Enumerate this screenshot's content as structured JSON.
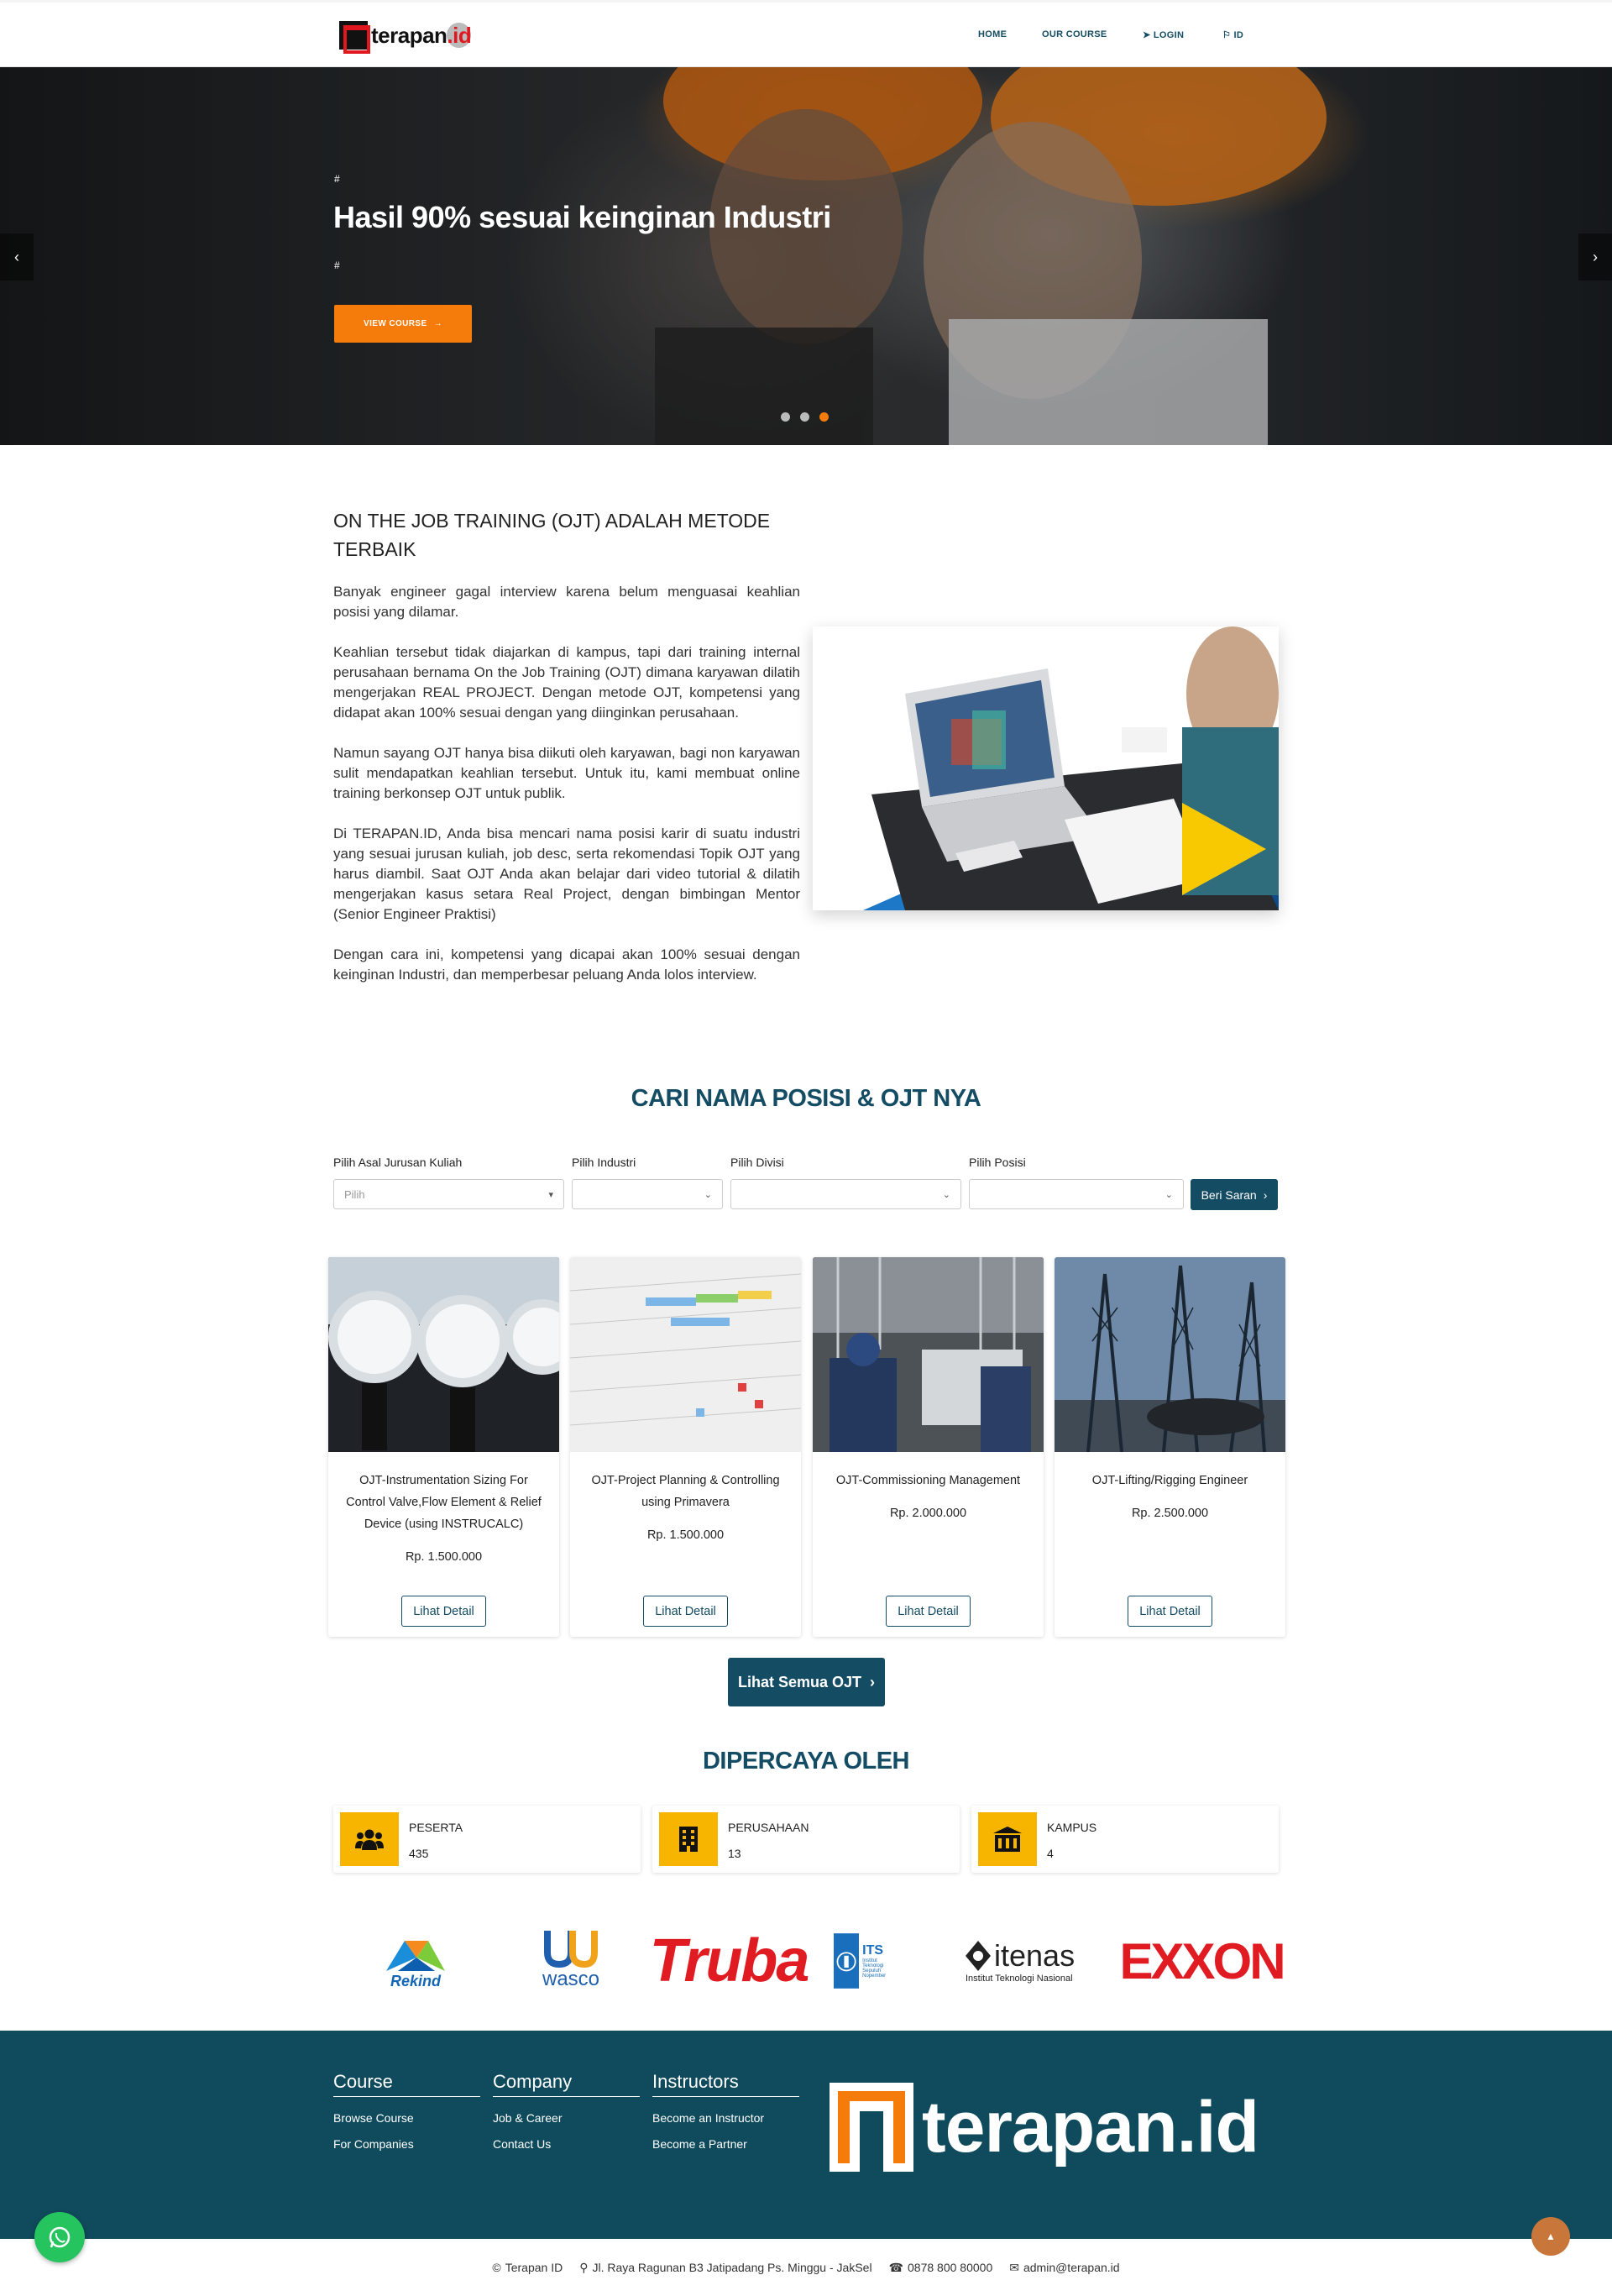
{
  "brand": {
    "name": "terapan",
    "tld": ".id"
  },
  "nav": {
    "home": "HOME",
    "course": "OUR COURSE",
    "login": "LOGIN",
    "lang": "ID"
  },
  "hero": {
    "hash_top": "#",
    "title": "Hasil 90% sesuai keinginan Industri",
    "hash_bottom": "#",
    "button": "VIEW COURSE"
  },
  "about": {
    "title": "ON THE JOB TRAINING (OJT) ADALAH METODE TERBAIK",
    "paragraphs": [
      "Banyak engineer gagal interview karena belum menguasai keahlian posisi yang dilamar.",
      "Keahlian tersebut tidak diajarkan di kampus, tapi dari training internal perusahaan bernama On the Job Training (OJT) dimana karyawan dilatih mengerjakan REAL PROJECT. Dengan metode OJT, kompetensi yang didapat akan 100% sesuai dengan yang diinginkan perusahaan.",
      "Namun sayang OJT hanya bisa diikuti oleh karyawan, bagi non karyawan sulit mendapatkan keahlian tersebut. Untuk itu, kami membuat online training berkonsep OJT untuk publik.",
      "Di TERAPAN.ID, Anda bisa mencari nama posisi karir di suatu industri yang sesuai jurusan kuliah, job desc, serta rekomendasi Topik OJT yang harus diambil. Saat OJT Anda akan belajar dari video tutorial & dilatih mengerjakan kasus setara Real Project, dengan bimbingan Mentor (Senior Engineer Praktisi)",
      "Dengan cara ini, kompetensi yang dicapai akan 100% sesuai dengan keinginan Industri, dan memperbesar peluang Anda lolos interview."
    ]
  },
  "search": {
    "title": "CARI NAMA POSISI & OJT NYA",
    "labels": {
      "jurusan": "Pilih Asal Jurusan Kuliah",
      "industri": "Pilih Industri",
      "divisi": "Pilih Divisi",
      "posisi": "Pilih Posisi"
    },
    "jurusan_placeholder": "Pilih",
    "button": "Beri Saran"
  },
  "courses": [
    {
      "title": "OJT-Instrumentation Sizing For Control Valve,Flow Element & Relief Device (using INSTRUCALC)",
      "price": "Rp. 1.500.000",
      "button": "Lihat Detail"
    },
    {
      "title": "OJT-Project Planning & Controlling using Primavera",
      "price": "Rp. 1.500.000",
      "button": "Lihat Detail"
    },
    {
      "title": "OJT-Commissioning Management",
      "price": "Rp. 2.000.000",
      "button": "Lihat Detail"
    },
    {
      "title": "OJT-Lifting/Rigging Engineer",
      "price": "Rp. 2.500.000",
      "button": "Lihat Detail"
    }
  ],
  "all_courses": "Lihat Semua OJT",
  "trusted": {
    "title": "DIPERCAYA OLEH",
    "stats": [
      {
        "label": "PESERTA",
        "value": "435",
        "icon": "users-icon"
      },
      {
        "label": "PERUSAHAAN",
        "value": "13",
        "icon": "building-icon"
      },
      {
        "label": "KAMPUS",
        "value": "4",
        "icon": "university-icon"
      }
    ]
  },
  "partners": {
    "rekind": "Rekind",
    "wasco": "wasco",
    "truba": "Truba",
    "its_name": "ITS",
    "its_sub1": "Institut",
    "its_sub2": "Teknologi",
    "its_sub3": "Sepuluh Nopember",
    "itenas": "itenas",
    "itenas_sub": "Institut Teknologi Nasional",
    "exxon": "EXXON"
  },
  "footer": {
    "cols": [
      {
        "head": "Course",
        "links": [
          "Browse Course",
          "For Companies"
        ]
      },
      {
        "head": "Company",
        "links": [
          "Job & Career",
          "Contact Us"
        ]
      },
      {
        "head": "Instructors",
        "links": [
          "Become an Instructor",
          "Become a Partner"
        ]
      }
    ],
    "copyright": "Terapan ID",
    "address": "Jl. Raya Ragunan B3 Jatipadang Ps. Minggu - JakSel",
    "phone": "0878 800 80000",
    "email": "admin@terapan.id"
  },
  "colors": {
    "primary": "#134c63",
    "accent": "#f57c0a",
    "stat_icon_bg": "#f7b500",
    "footer_bg": "#0f4b5c"
  }
}
